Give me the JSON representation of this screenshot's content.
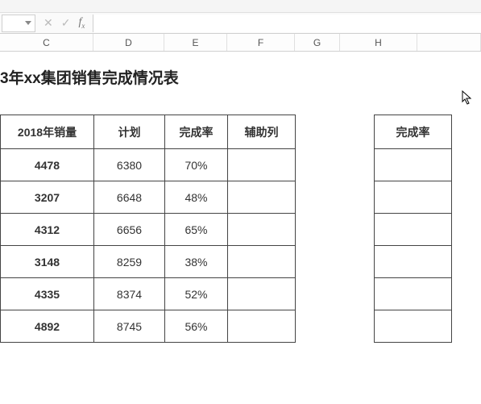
{
  "ribbon": {
    "frag1": "",
    "frag2": ""
  },
  "formula_bar": {
    "namebox_value": "",
    "cancel_glyph": "✕",
    "confirm_glyph": "✓",
    "fx_f": "f",
    "fx_x": "x",
    "formula_value": ""
  },
  "column_headers": {
    "blank_width": 0,
    "cols": [
      {
        "label": "C",
        "width": 116
      },
      {
        "label": "D",
        "width": 88
      },
      {
        "label": "E",
        "width": 78
      },
      {
        "label": "F",
        "width": 84
      },
      {
        "label": "G",
        "width": 56
      },
      {
        "label": "H",
        "width": 96
      },
      {
        "label": "",
        "width": 79
      }
    ]
  },
  "title": "3年xx集团销售完成情况表",
  "main_table": {
    "headers": {
      "c": "2018年销量",
      "d": "计划",
      "e": "完成率",
      "f": "辅助列"
    },
    "rows": [
      {
        "c": "4478",
        "d": "6380",
        "e": "70%",
        "f": ""
      },
      {
        "c": "3207",
        "d": "6648",
        "e": "48%",
        "f": ""
      },
      {
        "c": "4312",
        "d": "6656",
        "e": "65%",
        "f": ""
      },
      {
        "c": "3148",
        "d": "8259",
        "e": "38%",
        "f": ""
      },
      {
        "c": "4335",
        "d": "8374",
        "e": "52%",
        "f": ""
      },
      {
        "c": "4892",
        "d": "8745",
        "e": "56%",
        "f": ""
      }
    ]
  },
  "side_table": {
    "header": "完成率",
    "rows": [
      "",
      "",
      "",
      "",
      "",
      ""
    ]
  },
  "chart_data": {
    "type": "table",
    "title": "3年xx集团销售完成情况表",
    "columns": [
      "2018年销量",
      "计划",
      "完成率",
      "辅助列"
    ],
    "rows": [
      [
        4478,
        6380,
        0.7,
        null
      ],
      [
        3207,
        6648,
        0.48,
        null
      ],
      [
        4312,
        6656,
        0.65,
        null
      ],
      [
        3148,
        8259,
        0.38,
        null
      ],
      [
        4335,
        8374,
        0.52,
        null
      ],
      [
        4892,
        8745,
        0.56,
        null
      ]
    ]
  }
}
